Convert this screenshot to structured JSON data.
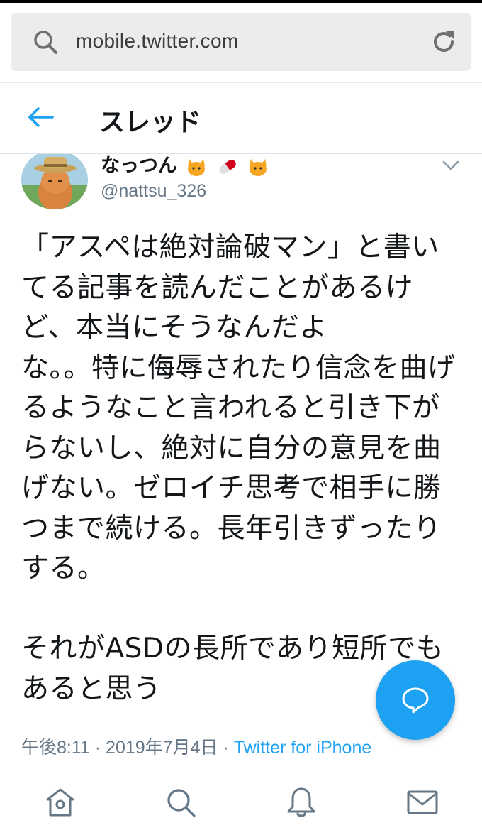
{
  "browser": {
    "url": "mobile.twitter.com",
    "icons": {
      "search": "search-icon",
      "reload": "reload-icon"
    }
  },
  "header": {
    "title": "スレッド",
    "back_icon": "back-arrow-icon"
  },
  "tweet": {
    "author": {
      "display_name": "なっつん",
      "name_emojis": [
        "cat-emoji",
        "pill-emoji",
        "cat-emoji"
      ],
      "handle": "@nattsu_326",
      "avatar": "cat-in-hat-avatar"
    },
    "text": "「アスペは絶対論破マン」と書いてる記事を読んだことがあるけど、本当にそうなんだよ\nな。。特に侮辱されたり信念を曲げるようなこと言われると引き下がらないし、絶対に自分の意見を曲げない。ゼロイチ思考で相手に勝つまで続ける。長年引きずったりする。\n\nそれがASDの長所であり短所でもあると思う",
    "time": "午後8:11",
    "separator": "·",
    "date": "2019年7月4日",
    "source": "Twitter for iPhone"
  },
  "fab": {
    "icon": "reply-bubble-icon"
  },
  "bottom_nav": {
    "items": [
      {
        "icon": "home-icon"
      },
      {
        "icon": "search-icon"
      },
      {
        "icon": "notifications-bell-icon"
      },
      {
        "icon": "messages-envelope-icon"
      }
    ]
  },
  "colors": {
    "accent": "#1da1f2",
    "text": "#14171a",
    "secondary_text": "#657786",
    "url_bar": "#ececec"
  }
}
